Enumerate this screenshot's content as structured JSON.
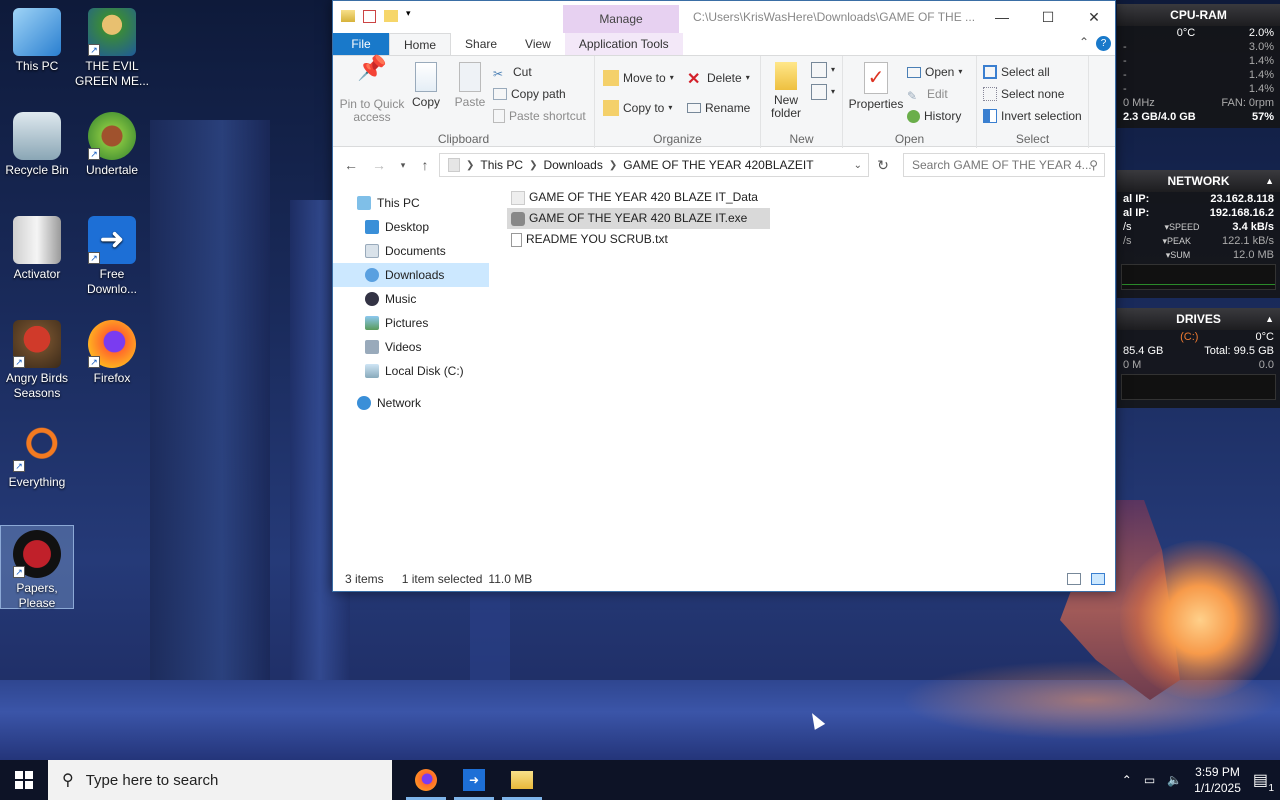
{
  "desktop": {
    "icons": [
      {
        "label": "This PC"
      },
      {
        "label": "THE EVIL GREEN ME..."
      },
      {
        "label": "Recycle Bin"
      },
      {
        "label": "Undertale"
      },
      {
        "label": "Activator"
      },
      {
        "label": "Free Downlo..."
      },
      {
        "label": "Angry Birds Seasons"
      },
      {
        "label": "Firefox"
      },
      {
        "label": "Everything"
      },
      {
        "label": "Papers, Please"
      }
    ]
  },
  "gadgets": {
    "cpu": {
      "title": "CPU-RAM",
      "temp": "0°C",
      "cpu_pct": "2.0%",
      "cores": [
        "3.0%",
        "1.4%",
        "1.4%",
        "1.4%"
      ],
      "mhz": "0 MHz",
      "fan": "FAN: 0rpm",
      "ram": "2.3 GB/4.0 GB",
      "ram_pct": "57%"
    },
    "network": {
      "title": "NETWORK",
      "ext_ip_label": "al IP:",
      "ext_ip": "23.162.8.118",
      "int_ip_label": "al IP:",
      "int_ip": "192.168.16.2",
      "speed_label": "SPEED",
      "speed": "3.4 kB/s",
      "peak_label": "PEAK",
      "peak": "122.1 kB/s",
      "sum_label": "SUM",
      "sum": "12.0 MB",
      "left1": "/s",
      "left2": "/s"
    },
    "drives": {
      "title": "DRIVES",
      "drive": "(C:)",
      "temp": "0°C",
      "free": "85.4 GB",
      "total": "Total: 99.5 GB",
      "left_read": "0 M",
      "right_read": "0.0"
    }
  },
  "explorer": {
    "manage_tab": "Manage",
    "title": "C:\\Users\\KrisWasHere\\Downloads\\GAME OF THE ...",
    "tabs": {
      "file": "File",
      "home": "Home",
      "share": "Share",
      "view": "View",
      "apptools": "Application Tools"
    },
    "clipboard": {
      "pin": "Pin to Quick access",
      "copy": "Copy",
      "paste": "Paste",
      "cut": "Cut",
      "copy_path": "Copy path",
      "paste_shortcut": "Paste shortcut",
      "label": "Clipboard"
    },
    "organize": {
      "move_to": "Move to",
      "copy_to": "Copy to",
      "delete": "Delete",
      "rename": "Rename",
      "label": "Organize"
    },
    "new": {
      "new_folder": "New folder",
      "label": "New"
    },
    "open": {
      "properties": "Properties",
      "open": "Open",
      "edit": "Edit",
      "history": "History",
      "label": "Open"
    },
    "select": {
      "select_all": "Select all",
      "select_none": "Select none",
      "invert": "Invert selection",
      "label": "Select"
    },
    "breadcrumb": [
      "This PC",
      "Downloads",
      "GAME OF THE YEAR 420BLAZEIT"
    ],
    "search_placeholder": "Search GAME OF THE YEAR 4...",
    "nav": [
      "This PC",
      "Desktop",
      "Documents",
      "Downloads",
      "Music",
      "Pictures",
      "Videos",
      "Local Disk (C:)",
      "Network"
    ],
    "files": [
      {
        "name": "GAME OF THE YEAR 420 BLAZE IT_Data",
        "type": "folder"
      },
      {
        "name": "GAME OF THE YEAR 420 BLAZE IT.exe",
        "type": "exe"
      },
      {
        "name": "README YOU SCRUB.txt",
        "type": "txt"
      }
    ],
    "status": {
      "items": "3 items",
      "selected": "1 item selected",
      "size": "11.0 MB"
    }
  },
  "taskbar": {
    "search_placeholder": "Type here to search",
    "time": "3:59 PM",
    "date": "1/1/2025",
    "notif_count": "1"
  }
}
